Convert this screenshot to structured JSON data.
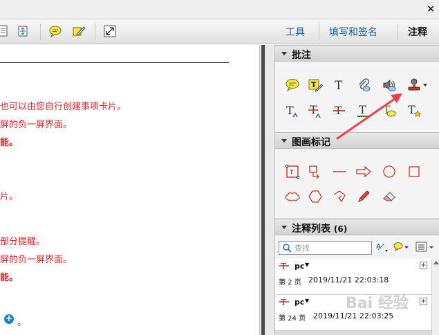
{
  "window": {
    "close_glyph": "×"
  },
  "toolbar": {
    "icons": [
      "page-icon",
      "fit-page-icon",
      "comment-bubble-icon",
      "sign-pen-icon",
      "fullscreen-icon"
    ],
    "tabs": [
      {
        "label": "工具",
        "active": false
      },
      {
        "label": "填写和签名",
        "active": false
      },
      {
        "label": "注释",
        "active": true
      }
    ]
  },
  "document": {
    "lines": [
      {
        "text": "也可以由您自行创建事项卡片。",
        "bold": false
      },
      {
        "text": "屏的负一屏界面。",
        "bold": false
      },
      {
        "text": "能。",
        "bold": true
      },
      {
        "text": "片。",
        "bold": false
      },
      {
        "text": "部分提醒。",
        "bold": false
      },
      {
        "text": "屏的负一屏界面。",
        "bold": false
      },
      {
        "text": "能。",
        "bold": true
      },
      {
        "text": "。",
        "bold": false
      }
    ]
  },
  "panel": {
    "annotations": {
      "title": "批注",
      "tools": [
        "sticky-note-icon",
        "highlight-text-icon",
        "add-text-icon",
        "attach-file-icon",
        "record-audio-icon",
        "stamp-icon",
        "insert-text-icon",
        "replace-text-icon",
        "strikethrough-icon",
        "underline-icon",
        "text-comment-icon",
        "text-correction-icon"
      ]
    },
    "drawing": {
      "title": "图画标记",
      "tools": [
        "text-box-icon",
        "callout-icon",
        "line-icon",
        "arrow-icon",
        "oval-icon",
        "rectangle-icon",
        "cloud-icon",
        "polygon-icon",
        "connected-lines-icon",
        "pencil-icon",
        "eraser-icon"
      ]
    },
    "comment_list": {
      "title": "注释列表",
      "count": "(6)",
      "search_placeholder": "查找",
      "items": [
        {
          "author": "pc",
          "page": "第 2 页",
          "time": "2019/11/21 22:03:18"
        },
        {
          "author": "pc",
          "page": "第 24 页",
          "time": "2019/11/21 22:03:25"
        }
      ]
    }
  },
  "watermark": "Bai 经验",
  "colors": {
    "doc_text": "#e0242a",
    "arrow": "#e8414d",
    "tab_link": "#1a5e8f"
  }
}
